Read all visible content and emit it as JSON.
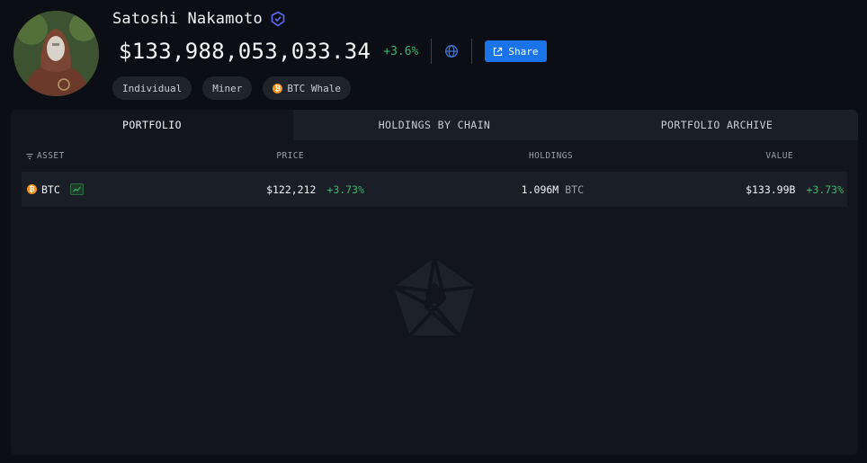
{
  "profile": {
    "name": "Satoshi Nakamoto",
    "avatar_icon": "statue-avatar",
    "verified_icon": "verified-badge-icon",
    "total_value": "$133,988,053,033.34",
    "total_change": "+3.6%",
    "share_label": "Share",
    "tags": [
      {
        "label": "Individual"
      },
      {
        "label": "Miner"
      },
      {
        "label": "BTC Whale",
        "icon": "btc-icon"
      }
    ]
  },
  "tabs": [
    {
      "label": "PORTFOLIO",
      "active": true
    },
    {
      "label": "HOLDINGS BY CHAIN",
      "active": false
    },
    {
      "label": "PORTFOLIO ARCHIVE",
      "active": false
    }
  ],
  "table": {
    "headers": {
      "asset": "ASSET",
      "price": "PRICE",
      "holdings": "HOLDINGS",
      "value": "VALUE"
    },
    "rows": [
      {
        "asset": "BTC",
        "price": "$122,212",
        "price_change": "+3.73%",
        "holdings": "1.096M",
        "holdings_unit": "BTC",
        "value": "$133.99B",
        "value_change": "+3.73%"
      }
    ]
  },
  "colors": {
    "background": "#0b0e14",
    "panel": "#12151c",
    "accent_blue": "#1a73e8",
    "positive_green": "#3fb56e",
    "btc_orange": "#f7931a"
  },
  "watermark_icon": "arkham-logo-icon"
}
